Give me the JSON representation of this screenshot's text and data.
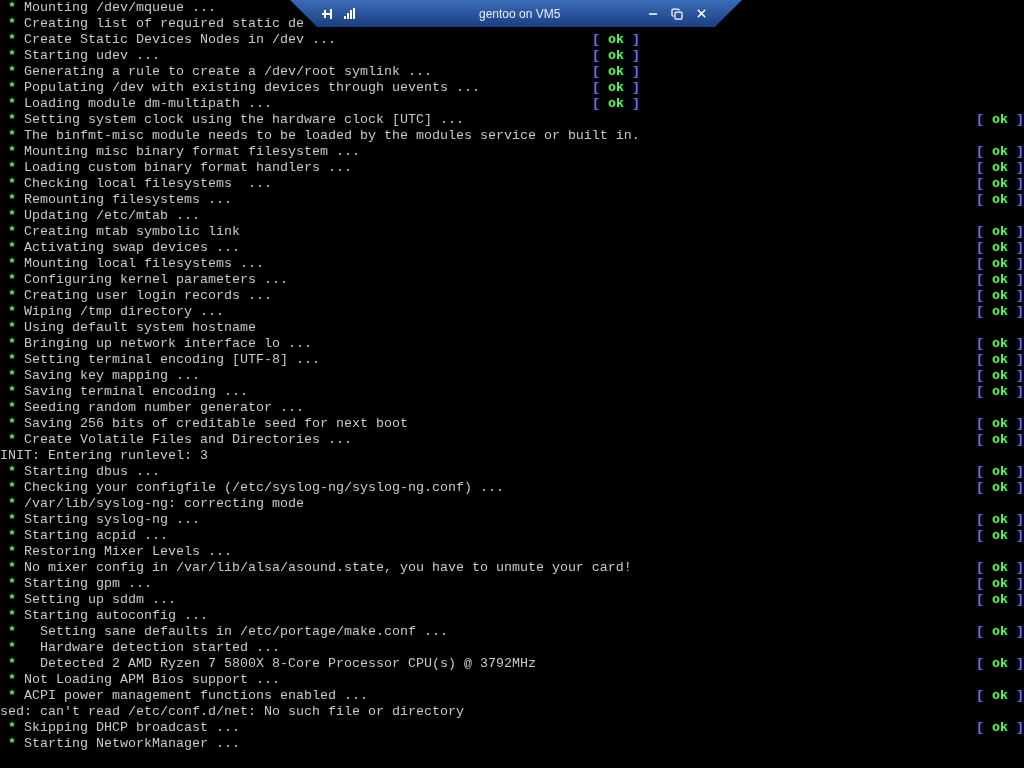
{
  "connection_bar": {
    "title": "gentoo on VM5"
  },
  "console_lines": [
    {
      "kind": "step",
      "bullet": "*",
      "text": "Mounting /dev/mqueue ..."
    },
    {
      "kind": "step",
      "bullet": "*",
      "text": "Creating list of required static de"
    },
    {
      "kind": "step",
      "bullet": "*",
      "text": "Create Static Devices Nodes in /dev ...",
      "status": {
        "left": "[",
        "label": "ok",
        "right": "]",
        "kind": "narrow"
      }
    },
    {
      "kind": "step",
      "bullet": "*",
      "text": "Starting udev ...",
      "status": {
        "left": "[",
        "label": "ok",
        "right": "]",
        "kind": "narrow"
      }
    },
    {
      "kind": "step",
      "bullet": "*",
      "text": "Generating a rule to create a /dev/root symlink ...",
      "status": {
        "left": "[",
        "label": "ok",
        "right": "]",
        "kind": "narrow"
      }
    },
    {
      "kind": "step",
      "bullet": "*",
      "text": "Populating /dev with existing devices through uevents ...",
      "status": {
        "left": "[",
        "label": "ok",
        "right": "]",
        "kind": "narrow"
      }
    },
    {
      "kind": "step",
      "bullet": "*",
      "text": "Loading module dm-multipath ...",
      "status": {
        "left": "[",
        "label": "ok",
        "right": "]",
        "kind": "narrow"
      }
    },
    {
      "kind": "step",
      "bullet": "*",
      "text": "Setting system clock using the hardware clock [UTC] ...",
      "status": {
        "left": "[",
        "label": "ok",
        "right": "]",
        "kind": "wide"
      }
    },
    {
      "kind": "step",
      "bullet": "*",
      "text": "The binfmt-misc module needs to be loaded by the modules service or built in."
    },
    {
      "kind": "step",
      "bullet": "*",
      "text": "Mounting misc binary format filesystem ...",
      "status": {
        "left": "[",
        "label": "ok",
        "right": "]",
        "kind": "wide"
      }
    },
    {
      "kind": "step",
      "bullet": "*",
      "text": "Loading custom binary format handlers ...",
      "status": {
        "left": "[",
        "label": "ok",
        "right": "]",
        "kind": "wide"
      }
    },
    {
      "kind": "step",
      "bullet": "*",
      "text": "Checking local filesystems  ...",
      "status": {
        "left": "[",
        "label": "ok",
        "right": "]",
        "kind": "wide"
      }
    },
    {
      "kind": "step",
      "bullet": "*",
      "text": "Remounting filesystems ...",
      "status": {
        "left": "[",
        "label": "ok",
        "right": "]",
        "kind": "wide"
      }
    },
    {
      "kind": "step",
      "bullet": "*",
      "text": "Updating /etc/mtab ..."
    },
    {
      "kind": "step",
      "bullet": "*",
      "text": "Creating mtab symbolic link",
      "status": {
        "left": "[",
        "label": "ok",
        "right": "]",
        "kind": "wide"
      }
    },
    {
      "kind": "step",
      "bullet": "*",
      "text": "Activating swap devices ...",
      "status": {
        "left": "[",
        "label": "ok",
        "right": "]",
        "kind": "wide"
      }
    },
    {
      "kind": "step",
      "bullet": "*",
      "text": "Mounting local filesystems ...",
      "status": {
        "left": "[",
        "label": "ok",
        "right": "]",
        "kind": "wide"
      }
    },
    {
      "kind": "step",
      "bullet": "*",
      "text": "Configuring kernel parameters ...",
      "status": {
        "left": "[",
        "label": "ok",
        "right": "]",
        "kind": "wide"
      }
    },
    {
      "kind": "step",
      "bullet": "*",
      "text": "Creating user login records ...",
      "status": {
        "left": "[",
        "label": "ok",
        "right": "]",
        "kind": "wide"
      }
    },
    {
      "kind": "step",
      "bullet": "*",
      "text": "Wiping /tmp directory ...",
      "status": {
        "left": "[",
        "label": "ok",
        "right": "]",
        "kind": "wide"
      }
    },
    {
      "kind": "step",
      "bullet": "*",
      "text": "Using default system hostname"
    },
    {
      "kind": "step",
      "bullet": "*",
      "text": "Bringing up network interface lo ...",
      "status": {
        "left": "[",
        "label": "ok",
        "right": "]",
        "kind": "wide"
      }
    },
    {
      "kind": "step",
      "bullet": "*",
      "text": "Setting terminal encoding [UTF-8] ...",
      "status": {
        "left": "[",
        "label": "ok",
        "right": "]",
        "kind": "wide"
      }
    },
    {
      "kind": "step",
      "bullet": "*",
      "text": "Saving key mapping ...",
      "status": {
        "left": "[",
        "label": "ok",
        "right": "]",
        "kind": "wide"
      }
    },
    {
      "kind": "step",
      "bullet": "*",
      "text": "Saving terminal encoding ...",
      "status": {
        "left": "[",
        "label": "ok",
        "right": "]",
        "kind": "wide"
      }
    },
    {
      "kind": "step",
      "bullet": "*",
      "text": "Seeding random number generator ..."
    },
    {
      "kind": "step",
      "bullet": "*",
      "text": "Saving 256 bits of creditable seed for next boot",
      "status": {
        "left": "[",
        "label": "ok",
        "right": "]",
        "kind": "wide"
      }
    },
    {
      "kind": "step",
      "bullet": "*",
      "text": "Create Volatile Files and Directories ...",
      "status": {
        "left": "[",
        "label": "ok",
        "right": "]",
        "kind": "wide"
      }
    },
    {
      "kind": "plain",
      "text": "INIT: Entering runlevel: 3"
    },
    {
      "kind": "step",
      "bullet": "*",
      "text": "Starting dbus ...",
      "status": {
        "left": "[",
        "label": "ok",
        "right": "]",
        "kind": "wide"
      }
    },
    {
      "kind": "step",
      "bullet": "*",
      "text": "Checking your configfile (/etc/syslog-ng/syslog-ng.conf) ...",
      "status": {
        "left": "[",
        "label": "ok",
        "right": "]",
        "kind": "wide"
      }
    },
    {
      "kind": "step",
      "bullet": "*",
      "text": "/var/lib/syslog-ng: correcting mode"
    },
    {
      "kind": "step",
      "bullet": "*",
      "text": "Starting syslog-ng ...",
      "status": {
        "left": "[",
        "label": "ok",
        "right": "]",
        "kind": "wide"
      }
    },
    {
      "kind": "step",
      "bullet": "*",
      "text": "Starting acpid ...",
      "status": {
        "left": "[",
        "label": "ok",
        "right": "]",
        "kind": "wide"
      }
    },
    {
      "kind": "step",
      "bullet": "*",
      "text": "Restoring Mixer Levels ..."
    },
    {
      "kind": "step",
      "bullet": "*",
      "text": "No mixer config in /var/lib/alsa/asound.state, you have to unmute your card!",
      "status": {
        "left": "[",
        "label": "ok",
        "right": "]",
        "kind": "wide"
      }
    },
    {
      "kind": "step",
      "bullet": "*",
      "text": "Starting gpm ...",
      "status": {
        "left": "[",
        "label": "ok",
        "right": "]",
        "kind": "wide"
      }
    },
    {
      "kind": "step",
      "bullet": "*",
      "text": "Setting up sddm ...",
      "status": {
        "left": "[",
        "label": "ok",
        "right": "]",
        "kind": "wide"
      }
    },
    {
      "kind": "step",
      "bullet": "*",
      "text": "Starting autoconfig ..."
    },
    {
      "kind": "substep",
      "bullet": "*",
      "text": "Setting sane defaults in /etc/portage/make.conf ...",
      "status": {
        "left": "[",
        "label": "ok",
        "right": "]",
        "kind": "wide"
      }
    },
    {
      "kind": "substep",
      "bullet": "*",
      "text": "Hardware detection started ..."
    },
    {
      "kind": "substep",
      "bullet": "*",
      "text": "Detected 2 AMD Ryzen 7 5800X 8-Core Processor CPU(s) @ 3792MHz",
      "status": {
        "left": "[",
        "label": "ok",
        "right": "]",
        "kind": "wide"
      }
    },
    {
      "kind": "step",
      "bullet": "*",
      "text": "Not Loading APM Bios support ..."
    },
    {
      "kind": "step",
      "bullet": "*",
      "text": "ACPI power management functions enabled ...",
      "status": {
        "left": "[",
        "label": "ok",
        "right": "]",
        "kind": "wide"
      }
    },
    {
      "kind": "plain",
      "text": "sed: can't read /etc/conf.d/net: No such file or directory"
    },
    {
      "kind": "step",
      "bullet": "*",
      "text": "Skipping DHCP broadcast ...",
      "status": {
        "left": "[",
        "label": "ok",
        "right": "]",
        "kind": "wide"
      }
    },
    {
      "kind": "step",
      "bullet": "*",
      "text": "Starting NetworkManager ..."
    }
  ]
}
